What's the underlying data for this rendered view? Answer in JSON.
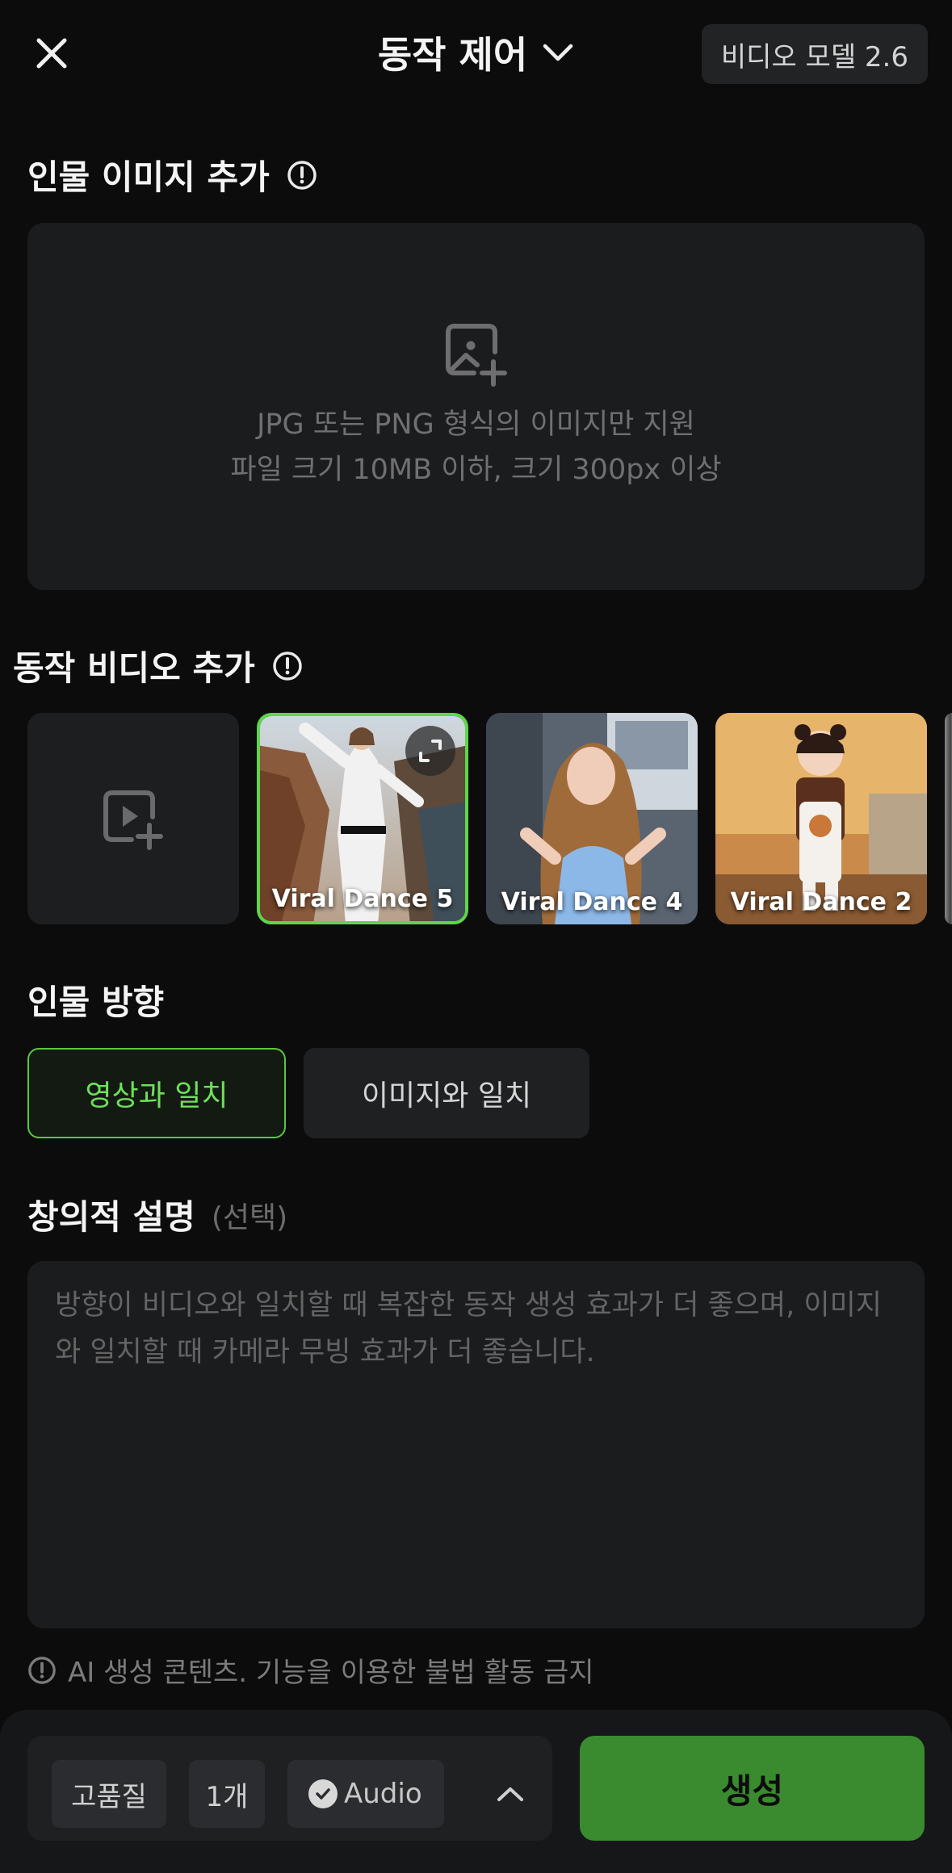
{
  "header": {
    "title": "동작 제어",
    "model_label": "비디오 모델 2.6"
  },
  "person_image": {
    "title": "인물 이미지 추가",
    "hint_line1": "JPG 또는 PNG 형식의 이미지만 지원",
    "hint_line2": "파일 크기 10MB 이하, 크기 300px 이상"
  },
  "motion_video": {
    "title": "동작 비디오 추가",
    "items": [
      {
        "label": "Viral Dance 5",
        "selected": true
      },
      {
        "label": "Viral Dance 4",
        "selected": false
      },
      {
        "label": "Viral Dance 2",
        "selected": false
      }
    ]
  },
  "orientation": {
    "title": "인물 방향",
    "options": [
      {
        "label": "영상과 일치",
        "selected": true
      },
      {
        "label": "이미지와 일치",
        "selected": false
      }
    ]
  },
  "description": {
    "title": "창의적 설명",
    "optional": "(선택)",
    "placeholder": "방향이 비디오와 일치할 때 복잡한 동작 생성 효과가 더 좋으며, 이미지와 일치할 때 카메라 무빙 효과가 더 좋습니다."
  },
  "notice": "AI 생성 콘텐츠. 기능을 이용한 불법 활동 금지",
  "bottom": {
    "quality": "고품질",
    "count": "1개",
    "audio": "Audio",
    "audio_checked": true,
    "generate": "생성"
  },
  "colors": {
    "accent_green": "#5fd64a",
    "generate_bg": "#3a8a2f",
    "background": "#0c0c0d"
  }
}
